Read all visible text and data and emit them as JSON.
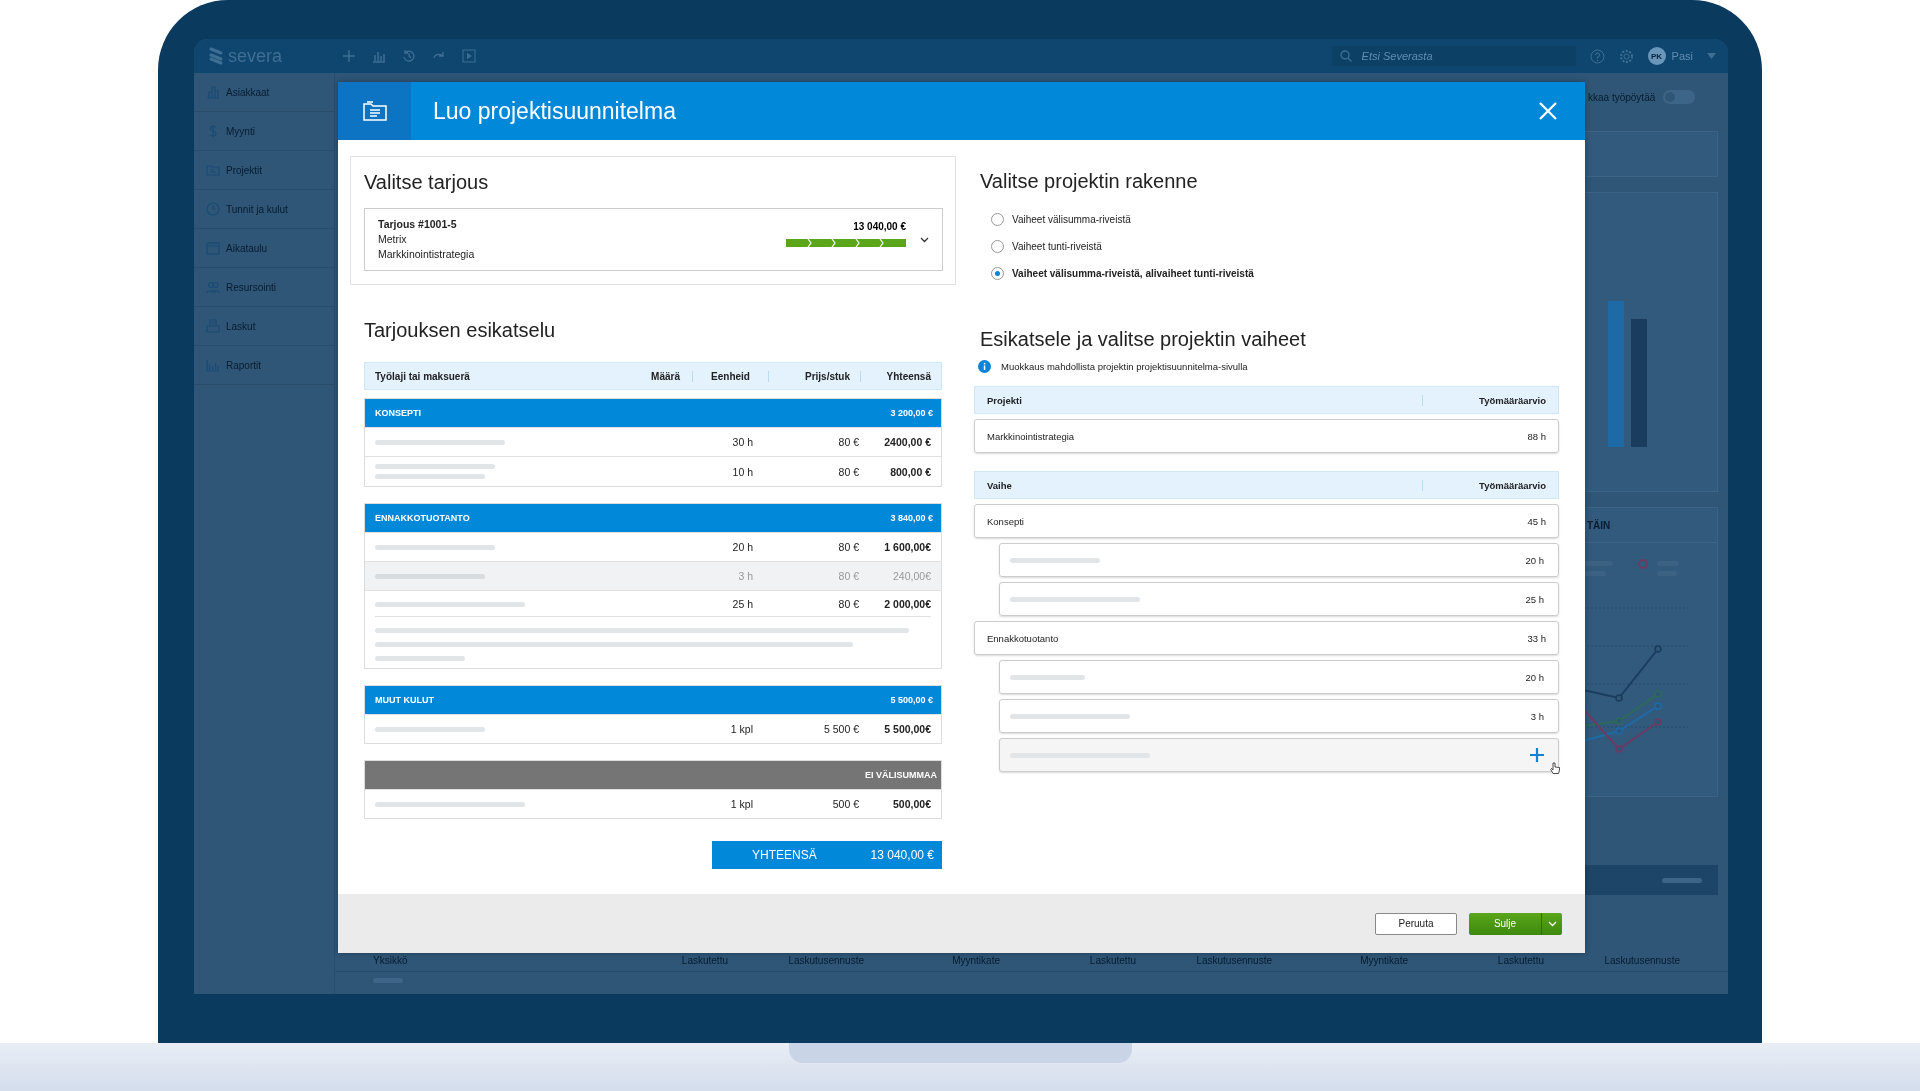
{
  "app": {
    "logo": "severa",
    "search_placeholder": "Etsi Severasta",
    "user_initials": "PK",
    "user_name": "Pasi",
    "sidebar": [
      {
        "label": "Asiakkaat"
      },
      {
        "label": "Myynti"
      },
      {
        "label": "Projektit"
      },
      {
        "label": "Tunnit ja kulut"
      },
      {
        "label": "Aikataulu"
      },
      {
        "label": "Resursointi"
      },
      {
        "label": "Laskut"
      },
      {
        "label": "Raportit"
      }
    ],
    "dashboard": {
      "toggle_label": "kkaa työpöytää",
      "toggle_on": false,
      "card_heading": "TÄIN",
      "table_columns": [
        "Yksikkö",
        "Laskutettu",
        "Laskutusennuste",
        "Myyntikate",
        "Laskutettu",
        "Laskutusennuste",
        "Myyntikate",
        "Laskutettu",
        "Laskutusennuste"
      ]
    }
  },
  "modal": {
    "title": "Luo projektisuunnitelma",
    "offer": {
      "heading": "Valitse tarjous",
      "number": "Tarjous #1001-5",
      "customer": "Metrix",
      "project": "Markkinointistrategia",
      "amount": "13 040,00 €",
      "level": 1
    },
    "preview": {
      "heading": "Tarjouksen esikatselu",
      "columns": [
        "Työlaji tai maksuerä",
        "Määrä",
        "Eenheid",
        "Prijs/stuk",
        "Yhteensä"
      ],
      "groups": [
        {
          "name": "KONSEPTI",
          "total": "3 200,00 €",
          "kind": "subtotal",
          "rows": [
            {
              "kind": "single",
              "quantity": "30 h",
              "price": "80 €",
              "total": "2400,00 €",
              "disabled": false
            },
            {
              "kind": "double",
              "quantity": "10 h",
              "price": "80 €",
              "total": "800,00 €",
              "disabled": false
            }
          ]
        },
        {
          "name": "ENNAKKOTUOTANTO",
          "total": "3 840,00 €",
          "kind": "subtotal",
          "rows": [
            {
              "kind": "single",
              "quantity": "20 h",
              "price": "80 €",
              "total": "1 600,00€",
              "disabled": false
            },
            {
              "kind": "single",
              "quantity": "3 h",
              "price": "80 €",
              "total": "240,00€",
              "disabled": true
            },
            {
              "kind": "with_note",
              "quantity": "25 h",
              "price": "80 €",
              "total": "2 000,00€",
              "disabled": false
            }
          ]
        },
        {
          "name": "MUUT KULUT",
          "total": "5 500,00 €",
          "kind": "subtotal",
          "rows": [
            {
              "kind": "single",
              "quantity": "1 kpl",
              "price": "5 500 €",
              "total": "5 500,00€",
              "disabled": false
            }
          ]
        },
        {
          "name": "EI VÄLISUMMAA",
          "kind": "no_subtotal",
          "rows": [
            {
              "kind": "single",
              "quantity": "1 kpl",
              "price": "500 €",
              "total": "500,00€",
              "disabled": false
            }
          ]
        }
      ],
      "total_label": "YHTEENSÄ",
      "total": "13 040,00 €"
    },
    "structure": {
      "heading": "Valitse projektin rakenne",
      "options": [
        {
          "label": "Vaiheet välisumma-riveistä",
          "selected": false
        },
        {
          "label": "Vaiheet tunti-riveistä",
          "selected": false
        },
        {
          "label": "Vaiheet välisumma-riveistä, alivaiheet tunti-riveistä",
          "selected": true
        }
      ]
    },
    "phases": {
      "heading": "Esikatsele ja valitse projektin vaiheet",
      "info": "Muokkaus mahdollista projektin projektisuunnitelma-sivulla",
      "project_columns": [
        "Projekti",
        "Työmääräarvio"
      ],
      "project": {
        "name": "Markkinointistrategia",
        "hours": "88 h"
      },
      "phase_columns": [
        "Vaihe",
        "Työmääräarvio"
      ],
      "items": [
        {
          "name": "Konsepti",
          "hours": "45 h",
          "children": [
            {
              "hours": "20 h"
            },
            {
              "hours": "25 h"
            }
          ]
        },
        {
          "name": "Ennakkotuotanto",
          "hours": "33 h",
          "children": [
            {
              "hours": "20 h"
            },
            {
              "hours": "3 h"
            }
          ]
        }
      ]
    },
    "buttons": {
      "cancel": "Peruuta",
      "close": "Sulje"
    }
  }
}
